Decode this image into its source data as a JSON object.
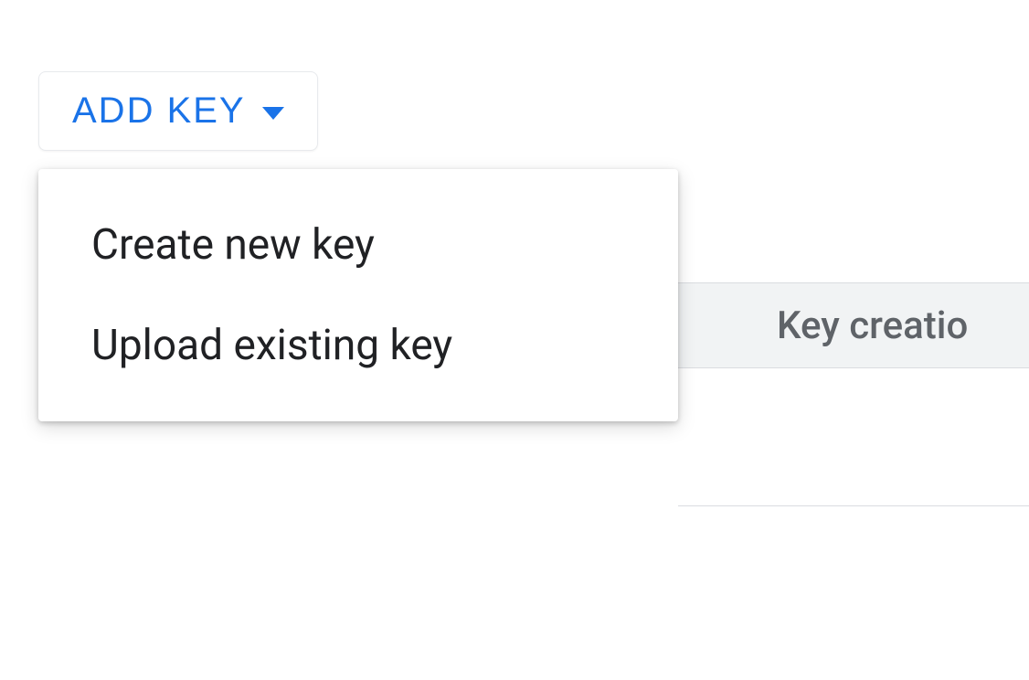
{
  "button": {
    "label": "ADD KEY"
  },
  "dropdown": {
    "items": [
      {
        "label": "Create new key"
      },
      {
        "label": "Upload existing key"
      }
    ]
  },
  "table": {
    "header": "Key creatio"
  }
}
